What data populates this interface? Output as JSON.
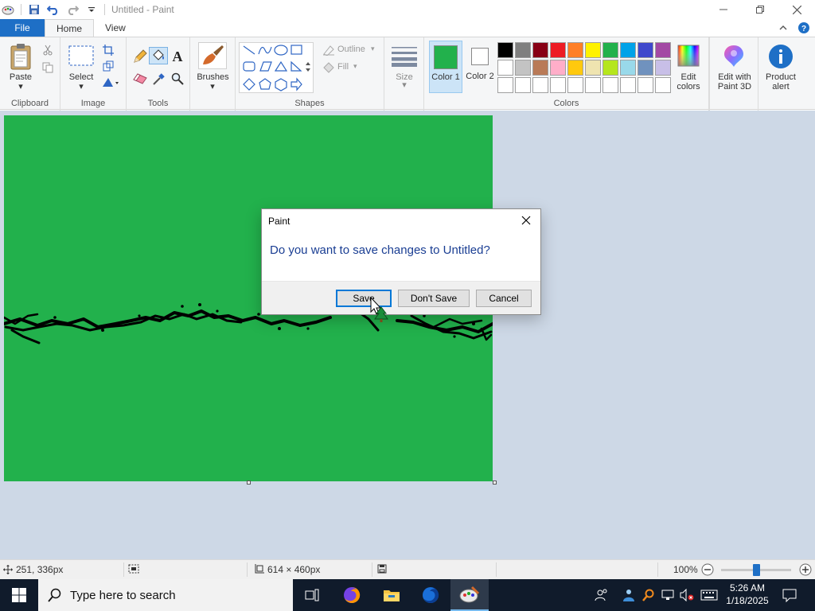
{
  "window": {
    "title": "Untitled - Paint",
    "controls": [
      "minimize",
      "maximize",
      "close"
    ]
  },
  "quick_access": [
    "paint-app-icon",
    "save-icon",
    "undo-icon",
    "redo-icon",
    "customize-dropdown-icon"
  ],
  "ribbon": {
    "tabs": {
      "file": "File",
      "home": "Home",
      "view": "View"
    },
    "clipboard": {
      "paste": "Paste",
      "group": "Clipboard"
    },
    "image": {
      "select": "Select",
      "group": "Image"
    },
    "tools": {
      "group": "Tools"
    },
    "brushes": {
      "label": "Brushes"
    },
    "shapes": {
      "outline": "Outline",
      "fill": "Fill",
      "group": "Shapes"
    },
    "size": {
      "label": "Size"
    },
    "colors": {
      "color1": "Color 1",
      "color2": "Color 2",
      "group": "Colors",
      "edit_colors": "Edit colors",
      "color1_value": "#22b14c",
      "color2_value": "#ffffff",
      "palette_row1": [
        "#000000",
        "#7f7f7f",
        "#880015",
        "#ed1c24",
        "#ff7f27",
        "#fff200",
        "#22b14c",
        "#00a2e8",
        "#3f48cc",
        "#a349a4"
      ],
      "palette_row2": [
        "#ffffff",
        "#c3c3c3",
        "#b97a57",
        "#ffaec9",
        "#ffc90e",
        "#efe4b0",
        "#b5e61d",
        "#99d9ea",
        "#7092be",
        "#c8bfe7"
      ],
      "palette_row3": [
        "#ffffff",
        "#ffffff",
        "#ffffff",
        "#ffffff",
        "#ffffff",
        "#ffffff",
        "#ffffff",
        "#ffffff",
        "#ffffff",
        "#ffffff"
      ]
    },
    "edit_paint3d": {
      "line1": "Edit with",
      "line2": "Paint 3D"
    },
    "product_alert": {
      "line1": "Product",
      "line2": "alert"
    }
  },
  "canvas": {
    "background": "#22b14c"
  },
  "dialog": {
    "title": "Paint",
    "message": "Do you want to save changes to Untitled?",
    "save": "Save",
    "dont_save": "Don't Save",
    "cancel": "Cancel"
  },
  "status": {
    "cursor_pos": "251, 336px",
    "image_size": "614 × 460px",
    "zoom": "100%",
    "zoom_level": 0.5
  },
  "taskbar": {
    "search_placeholder": "Type here to search",
    "time": "5:26 AM",
    "date": "1/18/2025"
  }
}
